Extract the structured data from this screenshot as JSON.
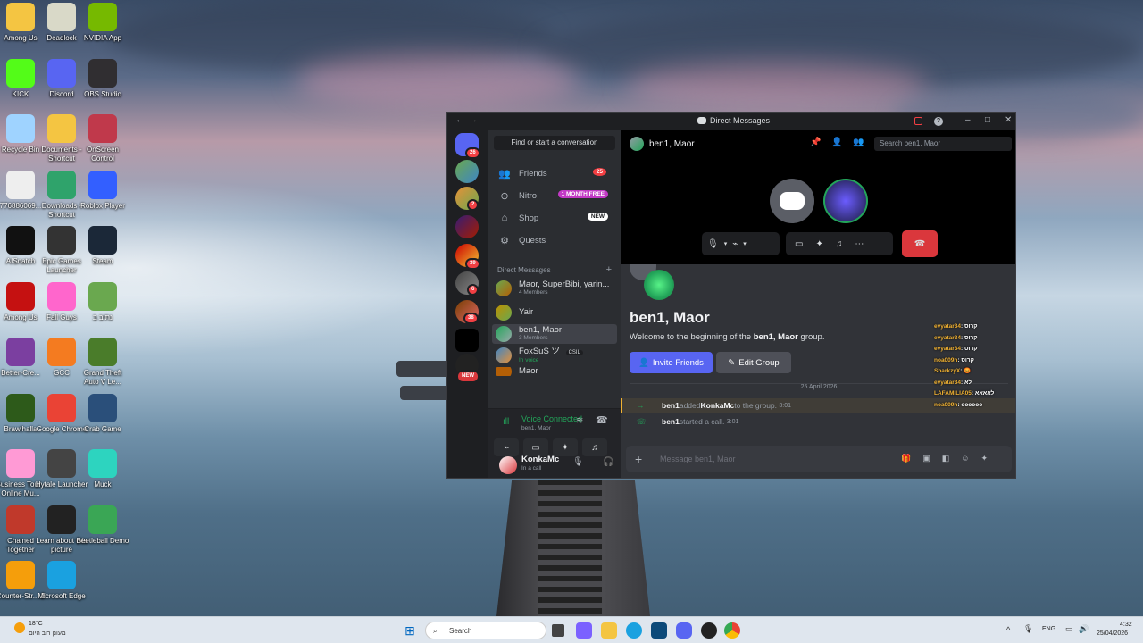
{
  "desktop": {
    "icons": [
      {
        "label": "Among Us"
      },
      {
        "label": "Deadlock"
      },
      {
        "label": "NVIDIA App"
      },
      {
        "label": "KICK"
      },
      {
        "label": "Discord"
      },
      {
        "label": "OBS Studio"
      },
      {
        "label": "Recycle Bin"
      },
      {
        "label": "Documents - Shortcut"
      },
      {
        "label": "OnScreen Control"
      },
      {
        "label": "776886069..."
      },
      {
        "label": "Downloads - Shortcut"
      },
      {
        "label": "Roblox Player"
      },
      {
        "label": "AISnatch"
      },
      {
        "label": "Epic Games Launcher"
      },
      {
        "label": "Steam"
      },
      {
        "label": "Among Us"
      },
      {
        "label": "Fall Guys"
      },
      {
        "label": "נתיב ב"
      },
      {
        "label": "Better-Cre..."
      },
      {
        "label": "GCC"
      },
      {
        "label": "Grand Theft Auto V Le..."
      },
      {
        "label": "Brawlhalla"
      },
      {
        "label": "Google Chrome"
      },
      {
        "label": "Crab Game"
      },
      {
        "label": "Business Tour - Online Mu..."
      },
      {
        "label": "Hytale Launcher"
      },
      {
        "label": "Muck"
      },
      {
        "label": "Chained Together"
      },
      {
        "label": "Learn about this picture"
      },
      {
        "label": "Beetleball Demo"
      },
      {
        "label": "Counter-Str... 2"
      },
      {
        "label": "Microsoft Edge"
      }
    ]
  },
  "discord": {
    "window_title": "Direct Messages",
    "guild_badges": [
      "26",
      "2",
      "6",
      "39",
      "6",
      "38"
    ],
    "new_badge": "NEW",
    "find_conversation": "Find or start a conversation",
    "nav": {
      "friends": {
        "label": "Friends",
        "badge": "25"
      },
      "nitro": {
        "label": "Nitro",
        "badge": "1 MONTH FREE"
      },
      "shop": {
        "label": "Shop",
        "badge": "NEW"
      },
      "quests": {
        "label": "Quests"
      }
    },
    "dm_header": "Direct Messages",
    "dms": [
      {
        "name": "Maor, SuperBibi, yarin...",
        "sub": "4 Members"
      },
      {
        "name": "Yair",
        "sub": ""
      },
      {
        "name": "ben1, Maor",
        "sub": "3 Members"
      },
      {
        "name": "FoxSuS ツ",
        "sub": "In voice",
        "tag": "CSIL"
      },
      {
        "name": "Maor",
        "sub": ""
      }
    ],
    "voice": {
      "status": "Voice Connected",
      "channel": "ben1, Maor"
    },
    "user": {
      "name": "KonkaMc",
      "status": "In a call"
    },
    "channel": {
      "name": "ben1, Maor",
      "search_placeholder": "Search ben1, Maor",
      "welcome_title": "ben1, Maor",
      "welcome_prefix": "Welcome to the beginning of the ",
      "welcome_group": "ben1, Maor",
      "welcome_suffix": " group.",
      "invite_label": "Invite Friends",
      "edit_label": "Edit Group",
      "date_divider": "25 April 2026",
      "messages": [
        {
          "actor": "ben1",
          "verb": " added ",
          "target": "KonkaMc",
          "rest": " to the group.",
          "time": "3:01"
        },
        {
          "actor": "ben1",
          "verb": " started a call.",
          "target": "",
          "rest": "",
          "time": "3:01"
        }
      ],
      "message_placeholder": "Message ben1, Maor"
    }
  },
  "overlay_chat": [
    {
      "name": "evyatar34",
      "text": ": קרוס"
    },
    {
      "name": "evyatar34",
      "text": ": קרוס"
    },
    {
      "name": "evyatar34",
      "text": ": קרוס"
    },
    {
      "name": "noa009h",
      "text": ": קרוס"
    },
    {
      "name": "SharkzyX",
      "text": ": 😡"
    },
    {
      "name": "evyatar34",
      "text": ": לא"
    },
    {
      "name": "LAFAMILIA05",
      "text": ": לאאאא"
    },
    {
      "name": "noa009h",
      "text": ": oooooo"
    }
  ],
  "taskbar": {
    "weather_temp": "18°C",
    "weather_desc": "מעונן רוב היום",
    "search": "Search",
    "lang": "ENG",
    "time": "4:32",
    "date": "25/04/2026"
  },
  "colors": {
    "blurple": "#5865f2",
    "red": "#da373c",
    "green": "#23a55a",
    "nitro_pink": "#c239c5"
  }
}
